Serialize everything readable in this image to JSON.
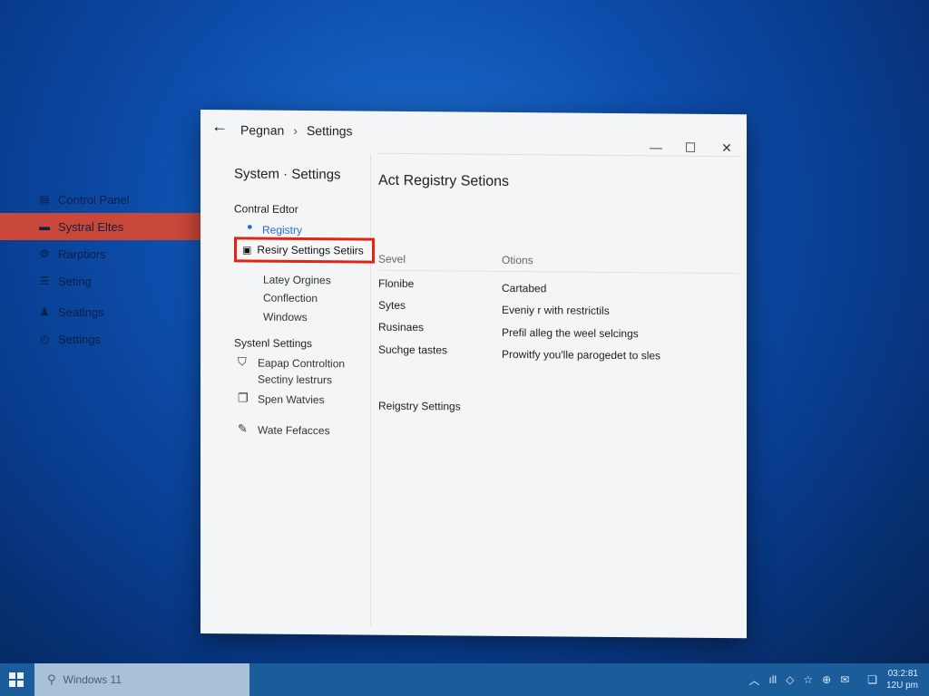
{
  "desktop_panel": {
    "items": [
      {
        "label": "Control Panel",
        "icon": "document-icon"
      },
      {
        "label": "Systral Eltes",
        "icon": "folder-icon",
        "active": true
      },
      {
        "label": "Rarptiors",
        "icon": "gear-icon"
      },
      {
        "label": "Seting",
        "icon": "list-icon"
      },
      {
        "label": "Seatings",
        "icon": "people-icon"
      },
      {
        "label": "Settings",
        "icon": "clock-icon"
      }
    ]
  },
  "window": {
    "breadcrumb": [
      "Pegnan",
      "Settings"
    ],
    "nav": {
      "title": "System · Settings",
      "section1": "Contral Edtor",
      "link": "Registry",
      "selected": "Resiry Settings Setiirs",
      "sub_items": [
        "Latey Orgines",
        "Conflection",
        "Windows"
      ],
      "section2": "Systenl Settings",
      "items": [
        {
          "label": "Eapap Controltion",
          "sub": "Sectiny lestrurs",
          "icon": "shield-icon"
        },
        {
          "label": "Spen Watvies",
          "icon": "copy-icon"
        },
        {
          "label": "Wate Fefacces",
          "icon": "pen-icon"
        }
      ]
    },
    "content": {
      "title": "Act Registry Setions",
      "col1": "Sevel",
      "col2": "Otions",
      "rows": [
        {
          "name": "Flonibe",
          "value": "Cartabed"
        },
        {
          "name": "Sytes",
          "value": "Eveniy r with restrictils"
        },
        {
          "name": "Rusinaes",
          "value": "Prefil alleg the weel selcings"
        },
        {
          "name": "Suchge tastes",
          "value": "Prowitfy you'lle parogedet to sles"
        }
      ],
      "footer_link": "Reigstry Settings"
    }
  },
  "taskbar": {
    "search_text": "Windows 11",
    "clock_top": "03:2:81",
    "clock_bottom": "12U pm"
  }
}
